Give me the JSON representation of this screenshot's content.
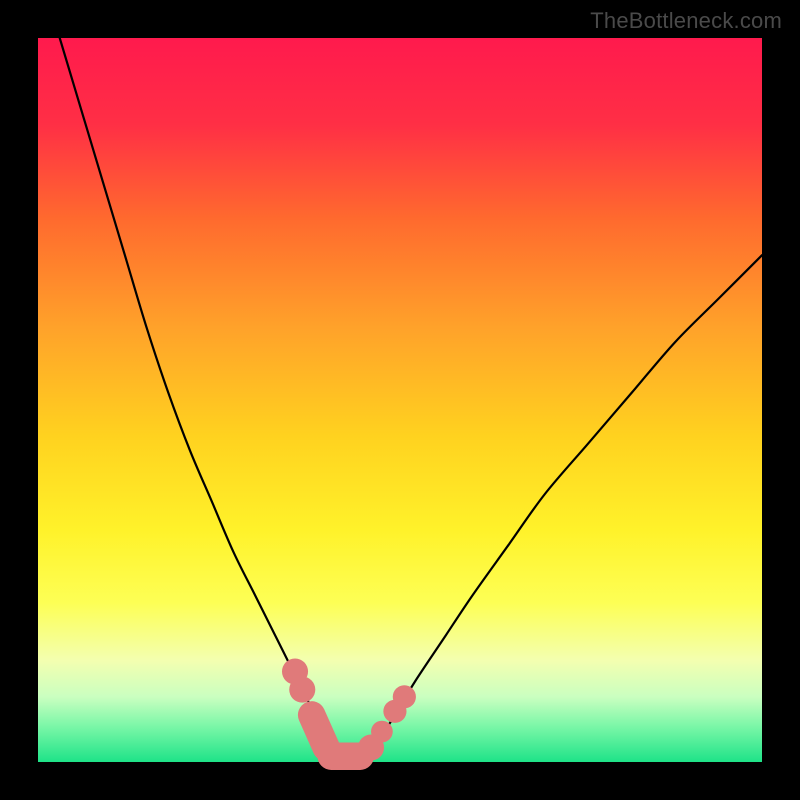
{
  "watermark": "TheBottleneck.com",
  "gradient": {
    "stops": [
      {
        "pct": 0,
        "color": "#ff1a4d"
      },
      {
        "pct": 12,
        "color": "#ff2f45"
      },
      {
        "pct": 25,
        "color": "#ff6a2e"
      },
      {
        "pct": 40,
        "color": "#ffa22a"
      },
      {
        "pct": 55,
        "color": "#ffd21f"
      },
      {
        "pct": 68,
        "color": "#fff22a"
      },
      {
        "pct": 78,
        "color": "#fdff55"
      },
      {
        "pct": 86,
        "color": "#f3ffb0"
      },
      {
        "pct": 91,
        "color": "#caffc0"
      },
      {
        "pct": 95,
        "color": "#7cf7a8"
      },
      {
        "pct": 100,
        "color": "#1ee388"
      }
    ]
  },
  "chart_data": {
    "type": "line",
    "title": "",
    "xlabel": "",
    "ylabel": "",
    "xlim": [
      0,
      100
    ],
    "ylim": [
      0,
      100
    ],
    "series": [
      {
        "name": "left-curve",
        "x": [
          3,
          6,
          9,
          12,
          15,
          18,
          21,
          24,
          27,
          30,
          33,
          35,
          37,
          39,
          40,
          41
        ],
        "y": [
          100,
          90,
          80,
          70,
          60,
          51,
          43,
          36,
          29,
          23,
          17,
          13,
          9,
          5,
          2,
          0
        ]
      },
      {
        "name": "right-curve",
        "x": [
          45,
          47,
          49,
          52,
          56,
          60,
          65,
          70,
          76,
          82,
          88,
          94,
          100
        ],
        "y": [
          0,
          3,
          6,
          11,
          17,
          23,
          30,
          37,
          44,
          51,
          58,
          64,
          70
        ]
      }
    ],
    "markers": [
      {
        "cx": 35.5,
        "cy": 12.5,
        "r": 1.8
      },
      {
        "cx": 36.5,
        "cy": 10.0,
        "r": 1.8
      },
      {
        "type": "pill",
        "x1": 37.8,
        "y1": 6.5,
        "x2": 39.8,
        "y2": 2.0,
        "w": 3.8
      },
      {
        "type": "pill",
        "x1": 40.5,
        "y1": 0.8,
        "x2": 44.5,
        "y2": 0.8,
        "w": 3.8
      },
      {
        "cx": 46.0,
        "cy": 2.0,
        "r": 1.8
      },
      {
        "cx": 47.5,
        "cy": 4.2,
        "r": 1.5
      },
      {
        "cx": 49.3,
        "cy": 7.0,
        "r": 1.6
      },
      {
        "cx": 50.6,
        "cy": 9.0,
        "r": 1.6
      }
    ],
    "marker_color": "#e07a7a"
  }
}
